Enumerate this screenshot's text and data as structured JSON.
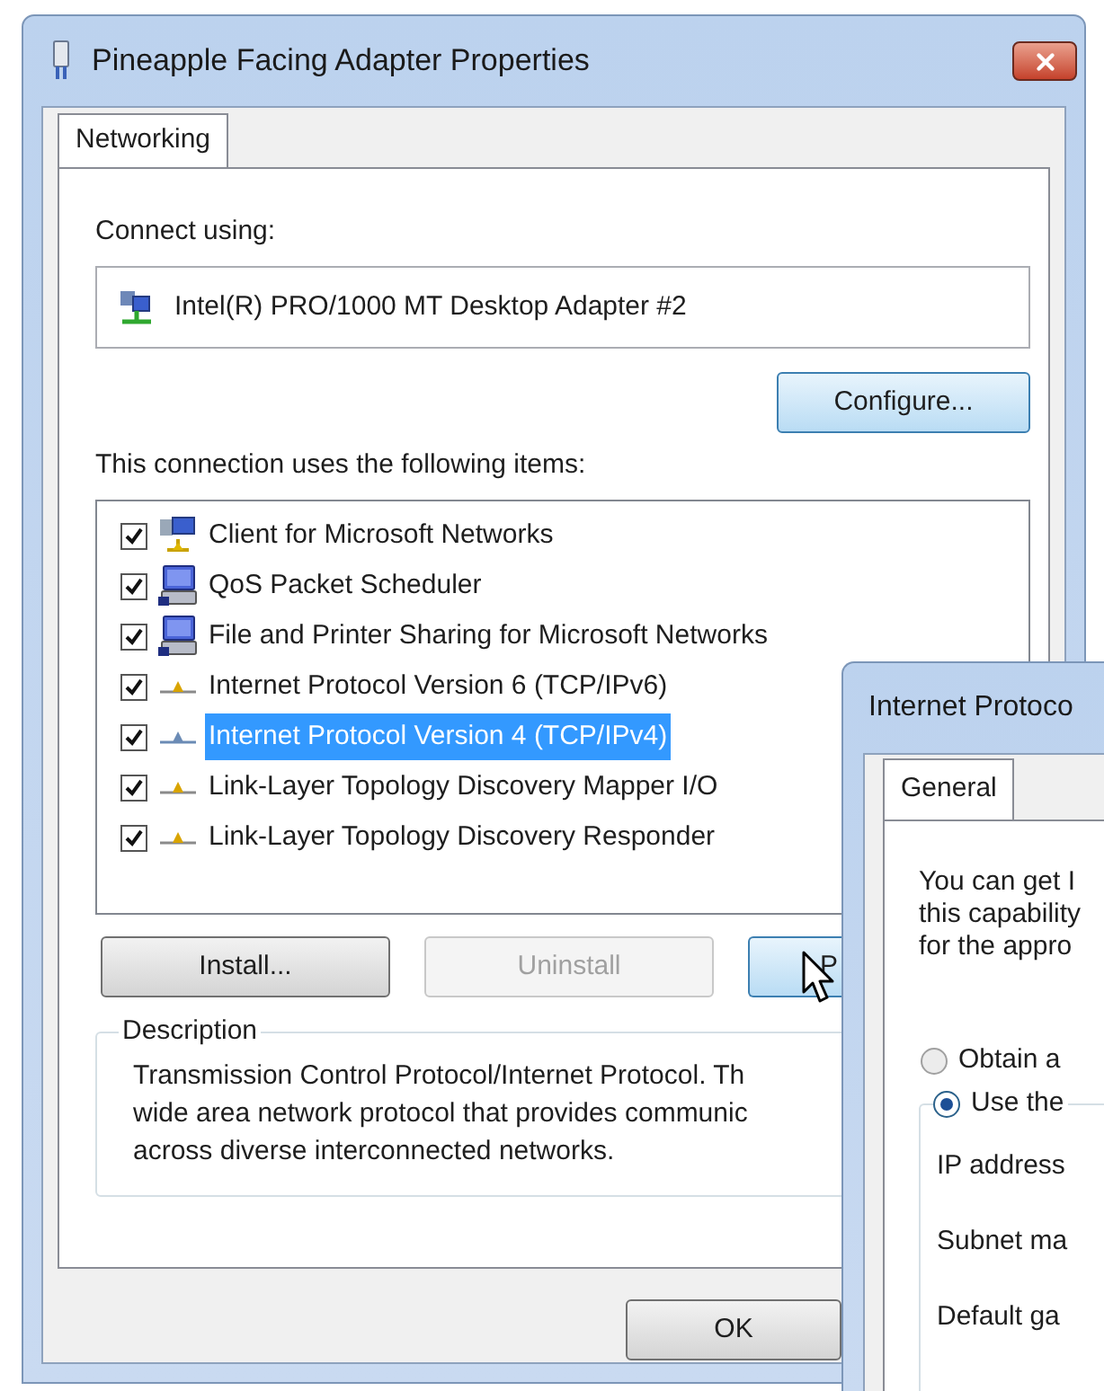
{
  "main_window": {
    "title": "Pineapple Facing Adapter Properties",
    "tabs": [
      {
        "label": "Networking",
        "selected": true
      }
    ],
    "connect_using_label": "Connect using:",
    "adapter": "Intel(R) PRO/1000 MT Desktop Adapter #2",
    "configure_button": {
      "label": "Configure...",
      "highlighted": true
    },
    "items_label": "This connection uses the following items:",
    "items": [
      {
        "kind": "client",
        "label": "Client for Microsoft Networks",
        "checked": true,
        "selected": false
      },
      {
        "kind": "service",
        "label": "QoS Packet Scheduler",
        "checked": true,
        "selected": false
      },
      {
        "kind": "service",
        "label": "File and Printer Sharing for Microsoft Networks",
        "checked": true,
        "selected": false
      },
      {
        "kind": "protocol",
        "label": "Internet Protocol Version 6 (TCP/IPv6)",
        "checked": true,
        "selected": false
      },
      {
        "kind": "protocol",
        "label": "Internet Protocol Version 4 (TCP/IPv4)",
        "checked": true,
        "selected": true
      },
      {
        "kind": "protocol",
        "label": "Link-Layer Topology Discovery Mapper I/O",
        "checked": true,
        "selected": false
      },
      {
        "kind": "protocol",
        "label": "Link-Layer Topology Discovery Responder",
        "checked": true,
        "selected": false
      }
    ],
    "buttons": [
      {
        "label": "Install...",
        "disabled": false,
        "highlighted": false
      },
      {
        "label": "Uninstall",
        "disabled": true,
        "highlighted": false
      },
      {
        "label": "P",
        "disabled": false,
        "highlighted": true
      }
    ],
    "description": {
      "title": "Description",
      "lines": [
        "Transmission Control Protocol/Internet Protocol. Th",
        "wide area network protocol that provides communic",
        "across diverse interconnected networks."
      ]
    },
    "ok_button": {
      "label": "OK"
    }
  },
  "second_window": {
    "title": "Internet Protoco",
    "tabs": [
      {
        "label": "General",
        "selected": true
      }
    ],
    "intro_lines": [
      "You can get I",
      "this capability",
      "for the appro"
    ],
    "options": [
      {
        "label": "Obtain a",
        "selected": false
      },
      {
        "label": "Use the",
        "selected": true
      }
    ],
    "field_labels": [
      "IP address",
      "Subnet ma",
      "Default ga"
    ]
  }
}
